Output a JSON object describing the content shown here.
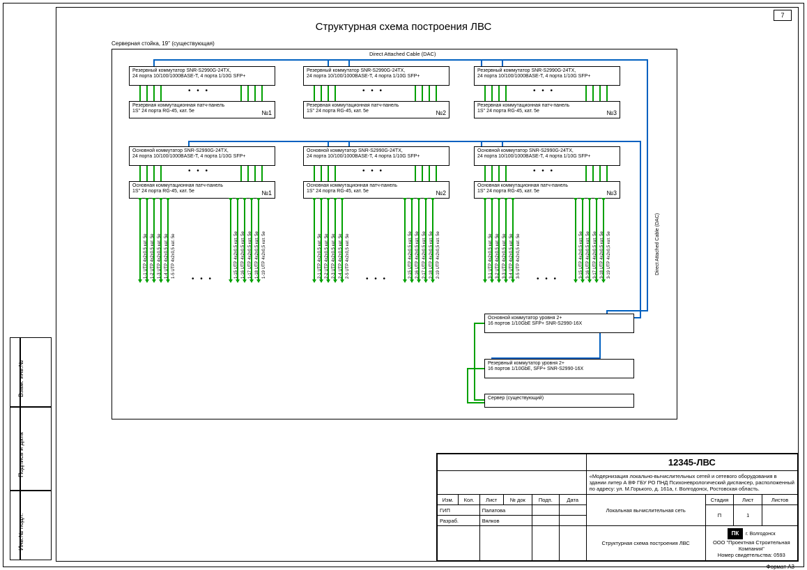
{
  "page_number": "7",
  "title": "Структурная схема построения ЛВС",
  "rack_label": "Серверная стойка, 19'' (существующая)",
  "dac_label_top": "Direct Attached Cable (DAC)",
  "dac_label_right": "Direct Attached Cable (DAC)",
  "switch_reserve": {
    "l1": "Резервный коммутатор SNR-S2990G-24TX,",
    "l2": "24 порта 10/100/1000BASE-T, 4 порта 1/10G SFP+"
  },
  "patch_reserve": {
    "l1": "Резервная коммутационная патч-панель",
    "l2": "1S'' 24 порта RG-45, кат. 5e"
  },
  "switch_main": {
    "l1": "Основной коммутатор SNR-S2990G-24TX,",
    "l2": "24 порта 10/100/1000BASE-T, 4 порта 1/10G SFP+"
  },
  "patch_main": {
    "l1": "Основная коммутационная патч-панель",
    "l2": "1S'' 24 порта RG-45, кат. 5e"
  },
  "numbers": [
    "№1",
    "№2",
    "№3"
  ],
  "cable_generic": "UTP 4x2x0,5 кат. 5e",
  "cable_sets": [
    [
      "1-1",
      "1-2",
      "1-3",
      "1-4",
      "1-5"
    ],
    [
      "1-15",
      "1-16",
      "1-17",
      "1-18",
      "1-19"
    ],
    [
      "2-1",
      "2-2",
      "2-3",
      "2-4",
      "2-5"
    ],
    [
      "2-15",
      "2-16",
      "2-17",
      "2-18",
      "2-19"
    ],
    [
      "3-1",
      "3-2",
      "3-3",
      "3-4",
      "3-5"
    ],
    [
      "3-15",
      "3-16",
      "3-17",
      "3-18",
      "3-19"
    ]
  ],
  "l2_main": {
    "l1": "Основной коммутатор уровня 2+",
    "l2": "16 портов 1/10GbE SFP+ SNR-S2990-16X"
  },
  "l2_reserve": {
    "l1": "Резервный коммутатор уровня 2+",
    "l2": "16 портов 1/10GbE, SFP+ SNR-S2990-16X"
  },
  "server": "Сервер (существующий)",
  "side_strip": {
    "a": "Инв.№ подл.",
    "b": "Подпись и дата",
    "c": "Взам. инв.№"
  },
  "title_block": {
    "proj_number": "12345-ЛВС",
    "project_desc": "«Модернизация локально-вычислительных сетей и сетевого оборудования в здании литер А ВФ ГБУ РО ПНД Психоневрологический диспансер, расположенный по адресу: ул. М.Горького,  д. 161а, г. Волгодонск, Ростовская область.",
    "row_headers": [
      "Изм.",
      "Кол.",
      "Лист",
      "№ док",
      "Подп.",
      "Дата"
    ],
    "gip_label": "ГИП",
    "gip_name": "Палатова",
    "dev_label": "Разраб.",
    "dev_name": "Вялков",
    "doc_title_1": "Локальная вычислительная сеть",
    "doc_title_2": "Структурная схема построения ЛВС",
    "stage_h": "Стадия",
    "sheet_h": "Лист",
    "sheets_h": "Листов",
    "stage": "П",
    "sheet": "1",
    "sheets": "",
    "company_city": "г. Волгодонск",
    "company_line": "ООО \"Проектная Строительная Компания\"",
    "cert_line": "Номер свидетельства: 0593",
    "format": "Формат А3"
  }
}
